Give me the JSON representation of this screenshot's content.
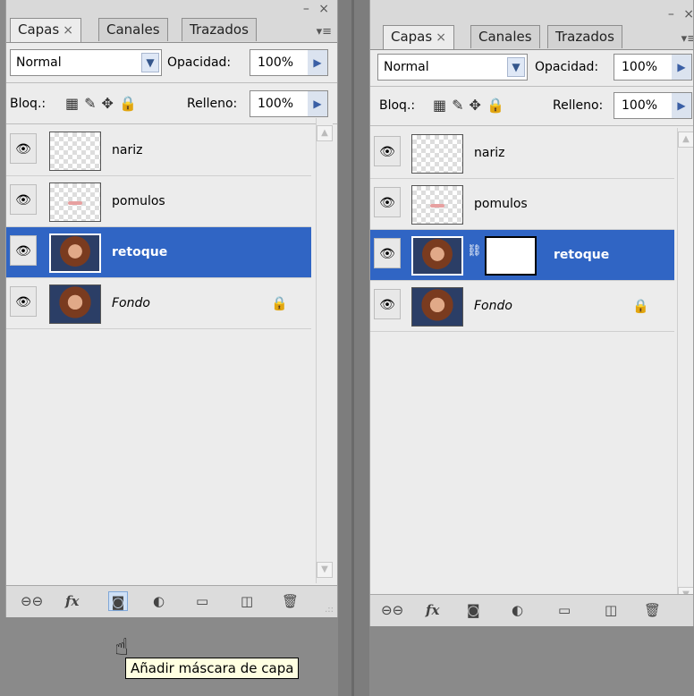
{
  "left_panel": {
    "tabs": [
      {
        "label": "Capas",
        "close": "×"
      },
      {
        "label": "Canales"
      },
      {
        "label": "Trazados"
      }
    ],
    "window_controls": "– ×",
    "menu_icon": "▾≡",
    "blend_mode": "Normal",
    "opacity_label": "Opacidad:",
    "opacity_value": "100%",
    "lock_label": "Bloq.:",
    "fill_label": "Relleno:",
    "fill_value": "100%",
    "layers": [
      {
        "name": "nariz",
        "thumb": "transparent",
        "selected": false
      },
      {
        "name": "pomulos",
        "thumb": "transparent-pink",
        "selected": false
      },
      {
        "name": "retoque",
        "thumb": "photo",
        "selected": true
      },
      {
        "name": "Fondo",
        "thumb": "photo",
        "selected": false,
        "locked": true
      }
    ],
    "bottom_icons": [
      "link-icon",
      "fx-icon",
      "add-mask-icon",
      "adjustment-icon",
      "folder-icon",
      "new-layer-icon",
      "trash-icon"
    ],
    "tooltip": "Añadir máscara de capa"
  },
  "right_panel": {
    "tabs": [
      {
        "label": "Capas",
        "close": "×"
      },
      {
        "label": "Canales"
      },
      {
        "label": "Trazados"
      }
    ],
    "window_controls": "– ×",
    "menu_icon": "▾≡",
    "blend_mode": "Normal",
    "opacity_label": "Opacidad:",
    "opacity_value": "100%",
    "lock_label": "Bloq.:",
    "fill_label": "Relleno:",
    "fill_value": "100%",
    "layers": [
      {
        "name": "nariz",
        "thumb": "transparent",
        "selected": false
      },
      {
        "name": "pomulos",
        "thumb": "transparent-pink",
        "selected": false
      },
      {
        "name": "retoque",
        "thumb": "photo",
        "mask": true,
        "selected": true
      },
      {
        "name": "Fondo",
        "thumb": "photo",
        "selected": false,
        "locked": true
      }
    ]
  },
  "glyphs": {
    "eye": "👁",
    "lock": "🔒",
    "chevron_down": "▼",
    "triangle_right": "▶",
    "scroll_up": "▲",
    "scroll_down": "▼",
    "link": "⊖⊖",
    "fx": "fx",
    "mask": "◙",
    "adjust": "◐",
    "folder": "▭",
    "newlayer": "◫",
    "trash": "🗑",
    "lock_transparent": "▦",
    "lock_brush": "✎",
    "lock_move": "✥",
    "lock_all": "🔒",
    "chain": "⛓",
    "cursor": "☝",
    "grip": ".::"
  }
}
